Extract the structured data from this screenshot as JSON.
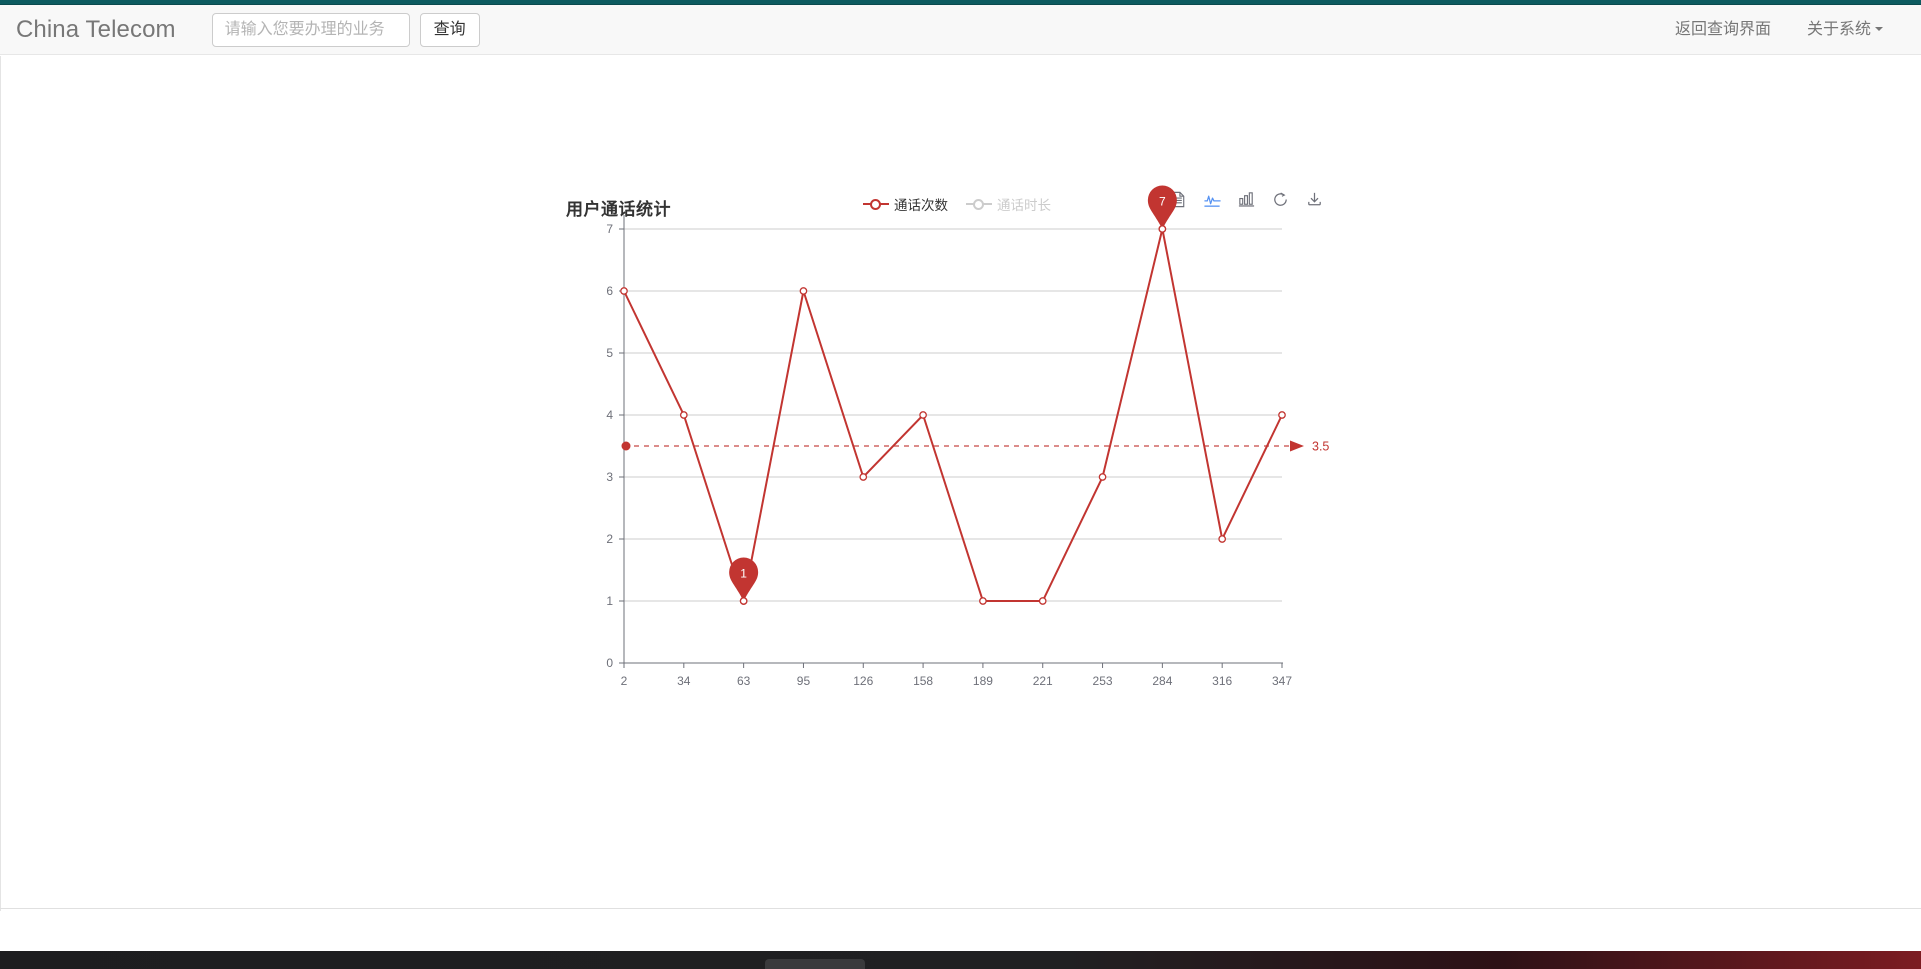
{
  "theme": {
    "accent_bar_color": "#0d5b60",
    "navbar_bg": "#f8f8f8",
    "series_color": "#c23531",
    "inactive_legend_color": "#cccccc",
    "toolbox_active_color": "#5793f3"
  },
  "navbar": {
    "brand": "China Telecom",
    "search": {
      "placeholder": "请输入您要办理的业务",
      "value": "",
      "submit_label": "查询"
    },
    "links": [
      {
        "label": "返回查询界面",
        "has_caret": false
      },
      {
        "label": "关于系统",
        "has_caret": true
      }
    ]
  },
  "chart_card": {
    "title": "用户通话统计",
    "legend": [
      {
        "label": "通话次数",
        "active": true,
        "icon": "line-circle-icon"
      },
      {
        "label": "通话时长",
        "active": false,
        "icon": "line-circle-icon"
      }
    ],
    "toolbox": [
      {
        "name": "data-view-icon",
        "label": "数据视图",
        "active": false
      },
      {
        "name": "line-chart-icon",
        "label": "切换为折线图",
        "active": true
      },
      {
        "name": "bar-chart-icon",
        "label": "切换为柱状图",
        "active": false
      },
      {
        "name": "restore-icon",
        "label": "还原",
        "active": false
      },
      {
        "name": "save-image-icon",
        "label": "保存为图片",
        "active": false
      }
    ]
  },
  "chart_data": {
    "type": "line",
    "title": "用户通话统计",
    "xlabel": "",
    "ylabel": "",
    "x": [
      "2",
      "34",
      "63",
      "95",
      "126",
      "158",
      "189",
      "221",
      "253",
      "284",
      "316",
      "347"
    ],
    "categories": [
      "2",
      "34",
      "63",
      "95",
      "126",
      "158",
      "189",
      "221",
      "253",
      "284",
      "316",
      "347"
    ],
    "series": [
      {
        "name": "通话次数",
        "color": "#c23531",
        "visible": true,
        "values": [
          6,
          4,
          1,
          6,
          3,
          4,
          1,
          1,
          3,
          7,
          2,
          4
        ],
        "symbol": "circle"
      },
      {
        "name": "通话时长",
        "color": "#cccccc",
        "visible": false,
        "values": []
      }
    ],
    "yticks": [
      0,
      1,
      2,
      3,
      4,
      5,
      6,
      7
    ],
    "ylim": [
      0,
      7
    ],
    "grid": true,
    "legend_position": "top-center",
    "mark_points": [
      {
        "type": "max",
        "label": "7",
        "x_index": 9,
        "value": 7
      },
      {
        "type": "min",
        "label": "1",
        "x_index": 2,
        "value": 1
      }
    ],
    "mark_line": {
      "type": "average",
      "label": "3.5",
      "value": 3.5
    }
  }
}
